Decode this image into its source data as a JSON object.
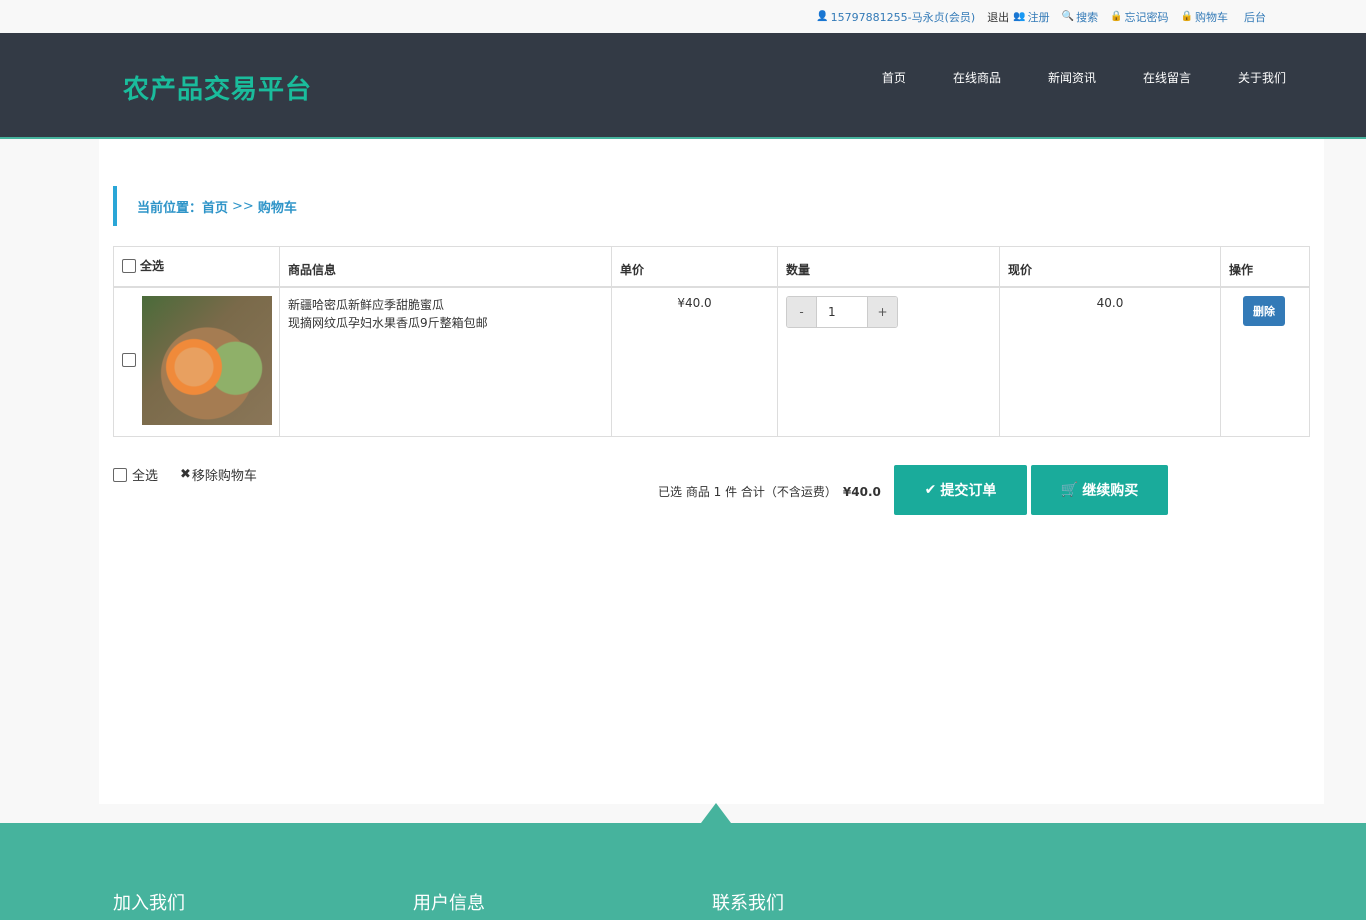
{
  "topbar": {
    "user": "15797881255-马永贞(会员)",
    "logout": "退出",
    "register": "注册",
    "search": "搜索",
    "forgot": "忘记密码",
    "cart": "购物车",
    "admin": "后台"
  },
  "header": {
    "logo": "农产品交易平台",
    "nav": [
      "首页",
      "在线商品",
      "新闻资讯",
      "在线留言",
      "关于我们"
    ]
  },
  "breadcrumb": {
    "label": "当前位置：",
    "home": "首页",
    "sep": ">>",
    "current": "购物车"
  },
  "table": {
    "headers": {
      "select_all": "全选",
      "info": "商品信息",
      "price": "单价",
      "qty": "数量",
      "now_price": "现价",
      "action": "操作"
    },
    "row": {
      "name_line1": "新疆哈密瓜新鲜应季甜脆蜜瓜",
      "name_line2": "现摘网纹瓜孕妇水果香瓜9斤整箱包邮",
      "price": "¥40.0",
      "qty": "1",
      "minus": "-",
      "plus": "+",
      "now_price": "40.0",
      "delete": "删除"
    }
  },
  "footer_bar": {
    "select_all": "全选",
    "remove": "移除购物车",
    "summary": "已选 商品 1 件 合计（不含运费）",
    "total": "¥40.0",
    "submit": "提交订单",
    "continue": "继续购买"
  },
  "site_footer": {
    "join": "加入我们",
    "user_info": "用户信息",
    "contact": "联系我们"
  }
}
